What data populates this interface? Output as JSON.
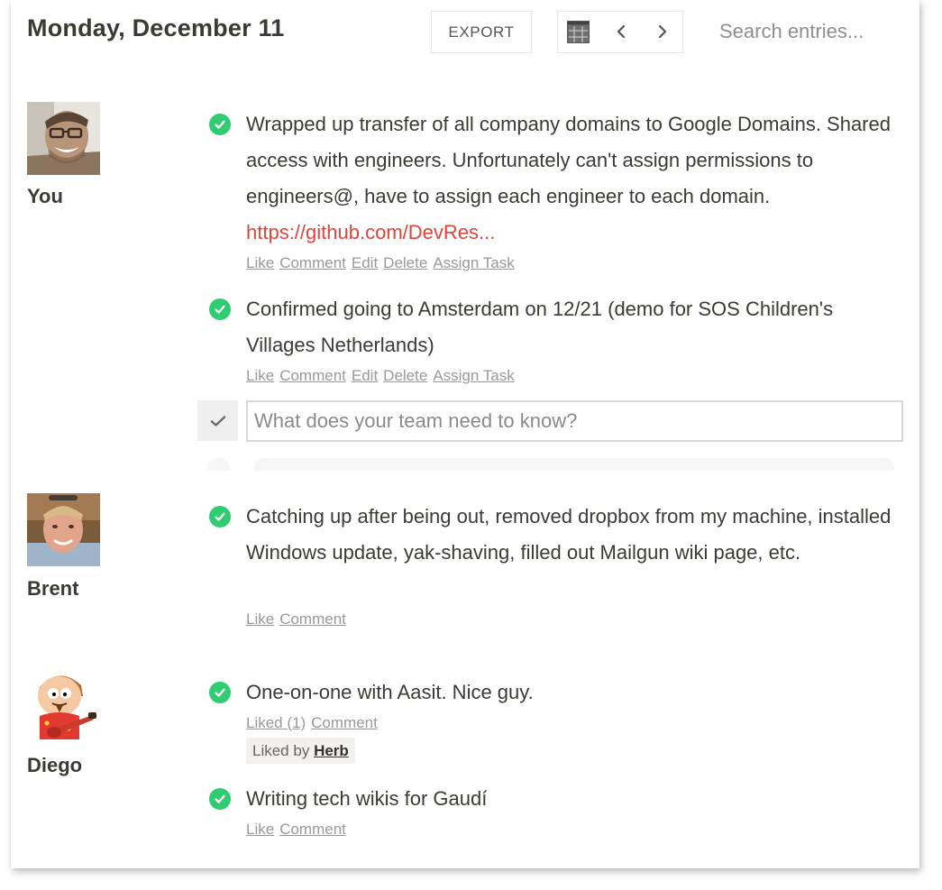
{
  "header": {
    "date_title": "Monday, December 11",
    "export_label": "EXPORT",
    "search_placeholder": "Search entries..."
  },
  "composer": {
    "placeholder": "What does your team need to know?"
  },
  "users": [
    {
      "name": "You",
      "entries": [
        {
          "text": "Wrapped up transfer of all company domains to Google Domains. Shared access with engineers. Unfortunately can't assign permissions to engineers@, have to assign each engineer to each domain. ",
          "link": "https://github.com/DevRes...",
          "actions": [
            "Like",
            "Comment",
            "Edit",
            "Delete",
            "Assign Task"
          ]
        },
        {
          "text": "Confirmed going to Amsterdam on 12/21 (demo for SOS Children's Villages Netherlands)",
          "actions": [
            "Like",
            "Comment",
            "Edit",
            "Delete",
            "Assign Task"
          ]
        }
      ]
    },
    {
      "name": "Brent",
      "entries": [
        {
          "text": "Catching up after being out, removed dropbox from my machine, installed Windows update, yak-shaving, filled out Mailgun wiki page, etc.",
          "actions": [
            "Like",
            "Comment"
          ]
        }
      ]
    },
    {
      "name": "Diego",
      "entries": [
        {
          "text": "One-on-one with Aasit. Nice guy.",
          "actions": [
            "Liked (1)",
            "Comment"
          ],
          "liked_by_label": "Liked by",
          "liked_by_user": "Herb"
        },
        {
          "text": "Writing tech wikis for Gaudí",
          "actions": [
            "Like",
            "Comment"
          ]
        }
      ]
    }
  ],
  "colors": {
    "check_green": "#2fcc71",
    "link_red": "#e0443a",
    "title_text": "#3b3b35",
    "action_gray": "#999999"
  },
  "icons": {
    "calendar": "calendar-grid-icon",
    "prev": "chevron-left-icon",
    "next": "chevron-right-icon",
    "done": "checkmark-circle-icon",
    "compose": "checkmark-icon"
  }
}
